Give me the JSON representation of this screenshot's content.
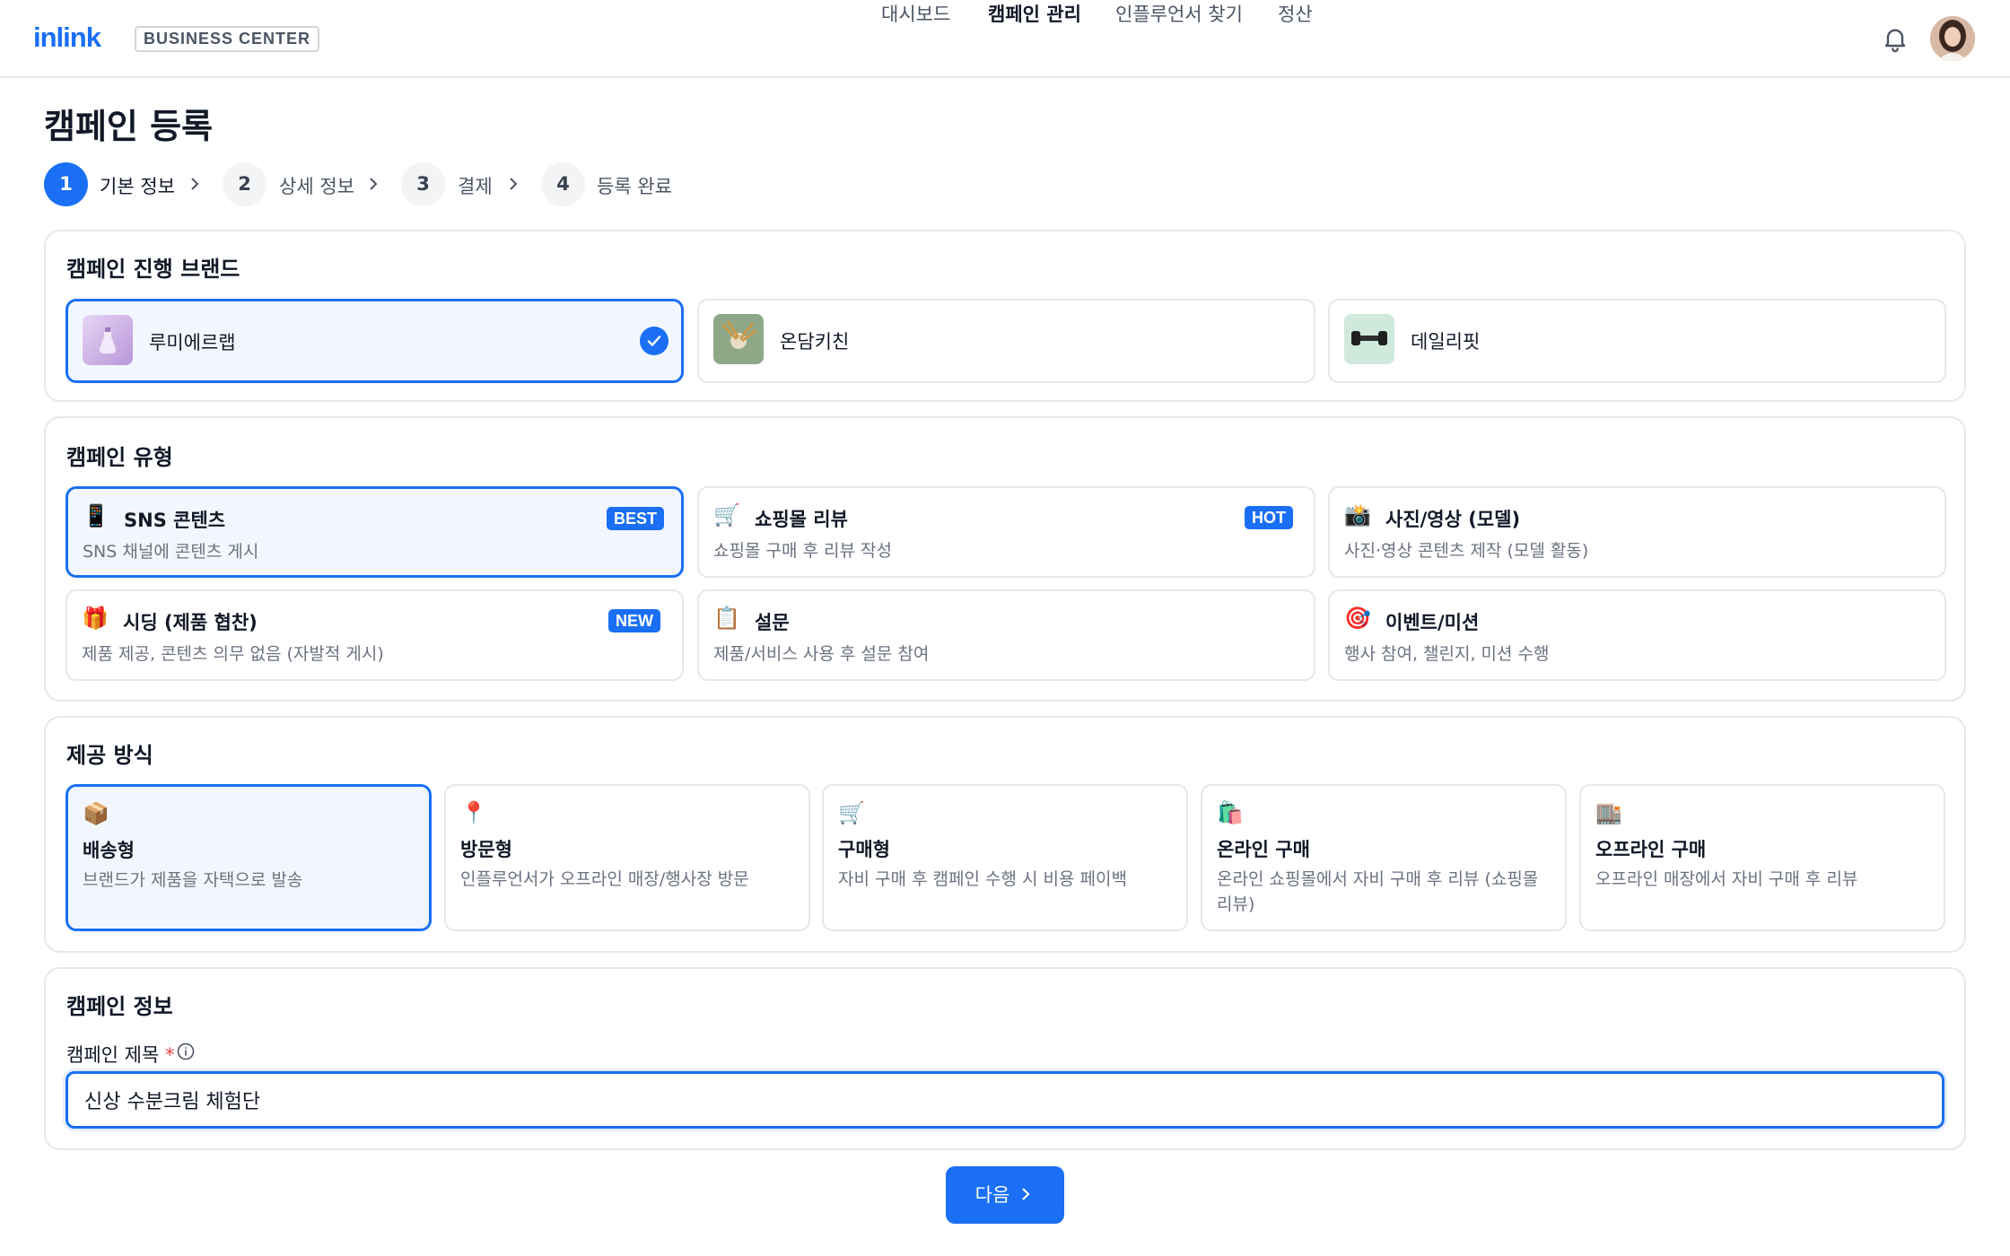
{
  "header": {
    "logo": "inlink",
    "business_badge": "BUSINESS CENTER",
    "nav": [
      {
        "label": "대시보드",
        "active": false
      },
      {
        "label": "캠페인 관리",
        "active": true
      },
      {
        "label": "인플루언서 찾기",
        "active": false
      },
      {
        "label": "정산",
        "active": false
      }
    ]
  },
  "page": {
    "title": "캠페인 등록"
  },
  "stepper": [
    {
      "number": "1",
      "label": "기본 정보",
      "active": true
    },
    {
      "number": "2",
      "label": "상세 정보",
      "active": false
    },
    {
      "number": "3",
      "label": "결제",
      "active": false
    },
    {
      "number": "4",
      "label": "등록 완료",
      "active": false
    }
  ],
  "brand_section": {
    "title": "캠페인 진행 브랜드",
    "brands": [
      {
        "name": "루미에르랩",
        "selected": true
      },
      {
        "name": "온담키친",
        "selected": false
      },
      {
        "name": "데일리핏",
        "selected": false
      }
    ]
  },
  "type_section": {
    "title": "캠페인 유형",
    "types": [
      {
        "icon": "📱",
        "title": "SNS 콘텐츠",
        "desc": "SNS 채널에 콘텐츠 게시",
        "badge": "BEST",
        "selected": true
      },
      {
        "icon": "🛒",
        "title": "쇼핑몰 리뷰",
        "desc": "쇼핑몰 구매 후 리뷰 작성",
        "badge": "HOT",
        "selected": false
      },
      {
        "icon": "📸",
        "title": "사진/영상 (모델)",
        "desc": "사진·영상 콘텐츠 제작 (모델 활동)",
        "badge": "",
        "selected": false
      },
      {
        "icon": "🎁",
        "title": "시딩 (제품 협찬)",
        "desc": "제품 제공, 콘텐츠 의무 없음 (자발적 게시)",
        "badge": "NEW",
        "selected": false
      },
      {
        "icon": "📋",
        "title": "설문",
        "desc": "제품/서비스 사용 후 설문 참여",
        "badge": "",
        "selected": false
      },
      {
        "icon": "🎯",
        "title": "이벤트/미션",
        "desc": "행사 참여, 챌린지, 미션 수행",
        "badge": "",
        "selected": false
      }
    ]
  },
  "provision_section": {
    "title": "제공 방식",
    "options": [
      {
        "icon": "📦",
        "title": "배송형",
        "desc": "브랜드가 제품을 자택으로 발송",
        "selected": true
      },
      {
        "icon": "📍",
        "title": "방문형",
        "desc": "인플루언서가 오프라인 매장/행사장 방문",
        "selected": false
      },
      {
        "icon": "🛒",
        "title": "구매형",
        "desc": "자비 구매 후 캠페인 수행 시 비용 페이백",
        "selected": false
      },
      {
        "icon": "🛍️",
        "title": "온라인 구매",
        "desc": "온라인 쇼핑몰에서 자비 구매 후 리뷰 (쇼핑몰 리뷰)",
        "selected": false
      },
      {
        "icon": "🏬",
        "title": "오프라인 구매",
        "desc": "오프라인 매장에서 자비 구매 후 리뷰",
        "selected": false
      }
    ]
  },
  "info_section": {
    "title": "캠페인 정보",
    "field_label": "캠페인 제목",
    "required_mark": "*",
    "title_value": "신상 수분크림 체험단"
  },
  "footer": {
    "next_label": "다음"
  },
  "colors": {
    "accent": "#1a6ff5",
    "selected_bg": "#f2f7ff",
    "border": "#e5e7eb"
  }
}
